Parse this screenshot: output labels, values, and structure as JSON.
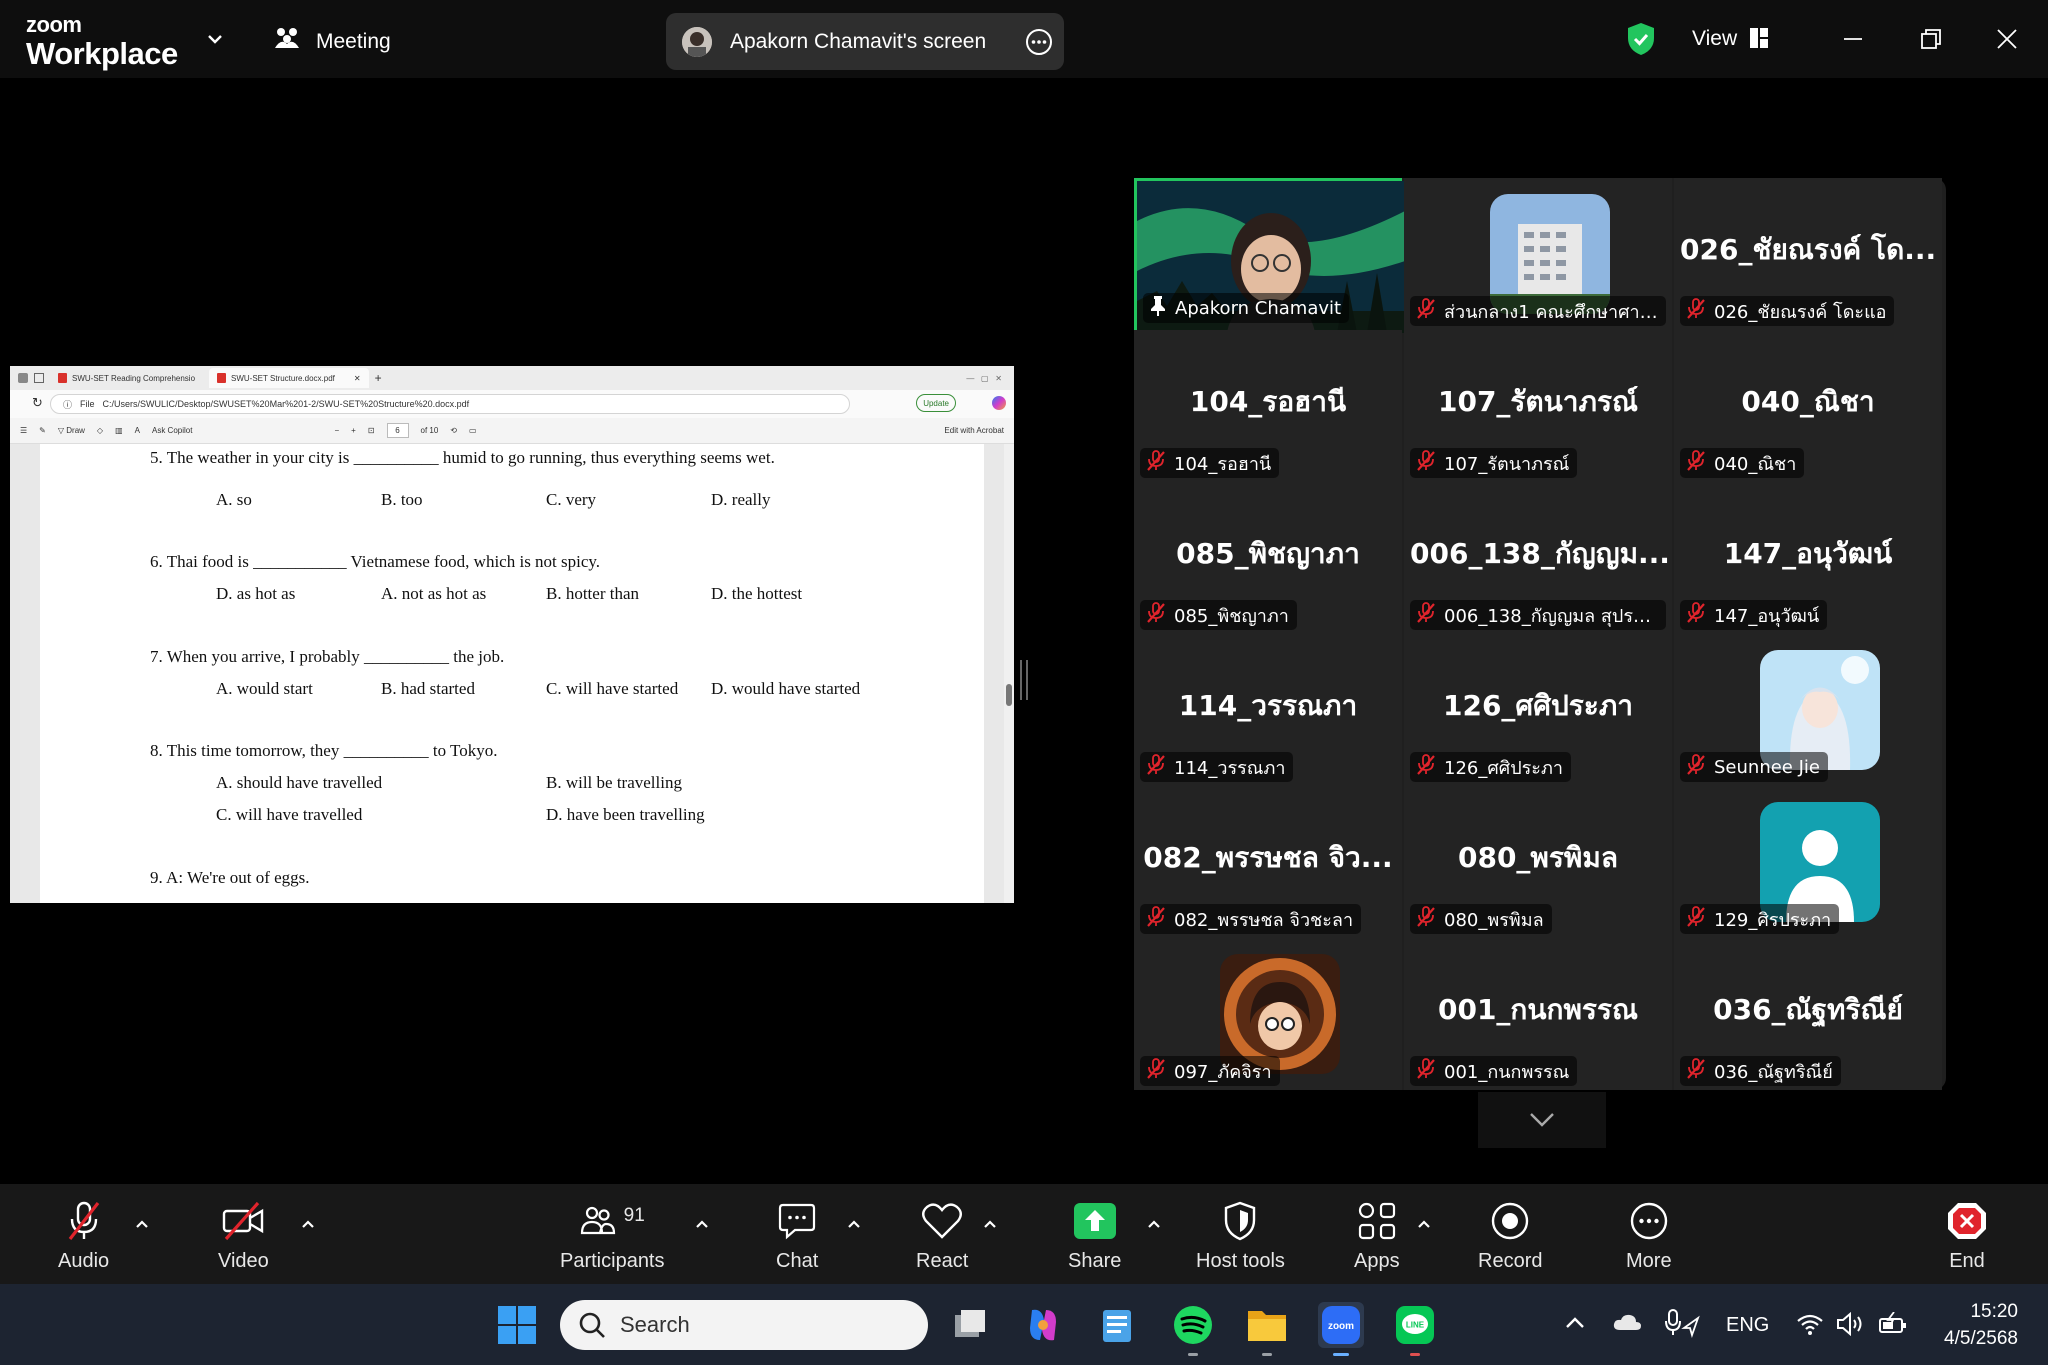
{
  "titlebar": {
    "logo_line1": "zoom",
    "logo_line2": "Workplace",
    "meeting_label": "Meeting",
    "screen_share_label": "Apakorn Chamavit's screen",
    "view_label": "View"
  },
  "browser": {
    "tab1": "SWU-SET Reading Comprehensio",
    "tab2": "SWU-SET Structure.docx.pdf",
    "file_label": "File",
    "address": "C:/Users/SWULIC/Desktop/SWUSET%20Mar%201-2/SWU-SET%20Structure%20.docx.pdf",
    "update_label": "Update",
    "draw_label": "Draw",
    "ask_copilot": "Ask Copilot",
    "page_num": "6",
    "page_total": "of 10",
    "edit_acrobat": "Edit with Acrobat"
  },
  "document": {
    "q5": "5. The weather in your city is __________ humid to go running, thus everything seems wet.",
    "q5_opts": [
      "A. so",
      "B. too",
      "C. very",
      "D. really"
    ],
    "q6": "6. Thai food is ___________ Vietnamese food, which is not spicy.",
    "q6_opts": [
      "D. as hot as",
      "A. not as hot as",
      "B. hotter than",
      "D. the hottest"
    ],
    "q7": "7. When you arrive, I probably __________ the job.",
    "q7_opts": [
      "A. would start",
      "B. had started",
      "C. will have started",
      "D. would have started"
    ],
    "q8": "8. This time tomorrow, they __________ to Tokyo.",
    "q8_opts": [
      "A.  should have travelled",
      "B. will be travelling",
      "C.  will have travelled",
      "D. have been travelling"
    ],
    "q9": "9. A: We're out of eggs."
  },
  "participants": [
    {
      "name": "Apakorn Chamavit",
      "big": "",
      "kind": "video"
    },
    {
      "name": "ส่วนกลาง1 คณะศึกษาศาส...",
      "big": "",
      "kind": "building"
    },
    {
      "name": "026_ชัยณรงค์ โดะแอ",
      "big": "026_ชัยณรงค์ โด...",
      "kind": "text"
    },
    {
      "name": "104_รอฮานี",
      "big": "104_รอฮานี",
      "kind": "text"
    },
    {
      "name": "107_รัตนาภรณ์",
      "big": "107_รัตนาภรณ์",
      "kind": "text"
    },
    {
      "name": "040_ณิชา",
      "big": "040_ณิชา",
      "kind": "text"
    },
    {
      "name": "085_พิชญาภา",
      "big": "085_พิชญาภา",
      "kind": "text"
    },
    {
      "name": "006_138_กัญญมล สุประวี...",
      "big": "006_138_กัญญม...",
      "kind": "text"
    },
    {
      "name": "147_อนุวัฒน์",
      "big": "147_อนุวัฒน์",
      "kind": "text"
    },
    {
      "name": "114_วรรณภา",
      "big": "114_วรรณภา",
      "kind": "text"
    },
    {
      "name": "126_ศศิประภา",
      "big": "126_ศศิประภา",
      "kind": "text"
    },
    {
      "name": "Seunnee Jie",
      "big": "",
      "kind": "anime"
    },
    {
      "name": "082_พรรษชล จิวชะลา",
      "big": "082_พรรษชล จิว...",
      "kind": "text"
    },
    {
      "name": "080_พรพิมล",
      "big": "080_พรพิมล",
      "kind": "text"
    },
    {
      "name": "129_ศิรประภา",
      "big": "",
      "kind": "default"
    },
    {
      "name": "097_ภัคจิรา",
      "big": "",
      "kind": "cartoon"
    },
    {
      "name": "001_กนกพรรณ",
      "big": "001_กนกพรรณ",
      "kind": "text"
    },
    {
      "name": "036_ณัฐทริณีย์",
      "big": "036_ณัฐทริณีย์",
      "kind": "text"
    }
  ],
  "toolbar": {
    "audio": "Audio",
    "video": "Video",
    "participants": "Participants",
    "participant_count": "91",
    "chat": "Chat",
    "react": "React",
    "share": "Share",
    "host_tools": "Host tools",
    "apps": "Apps",
    "record": "Record",
    "more": "More",
    "end": "End"
  },
  "taskbar": {
    "search_placeholder": "Search",
    "lang": "ENG",
    "time": "15:20",
    "date": "4/5/2568"
  },
  "colors": {
    "accent_green": "#22c55e",
    "mute_red": "#e0242c",
    "share_green": "#22c55e"
  }
}
